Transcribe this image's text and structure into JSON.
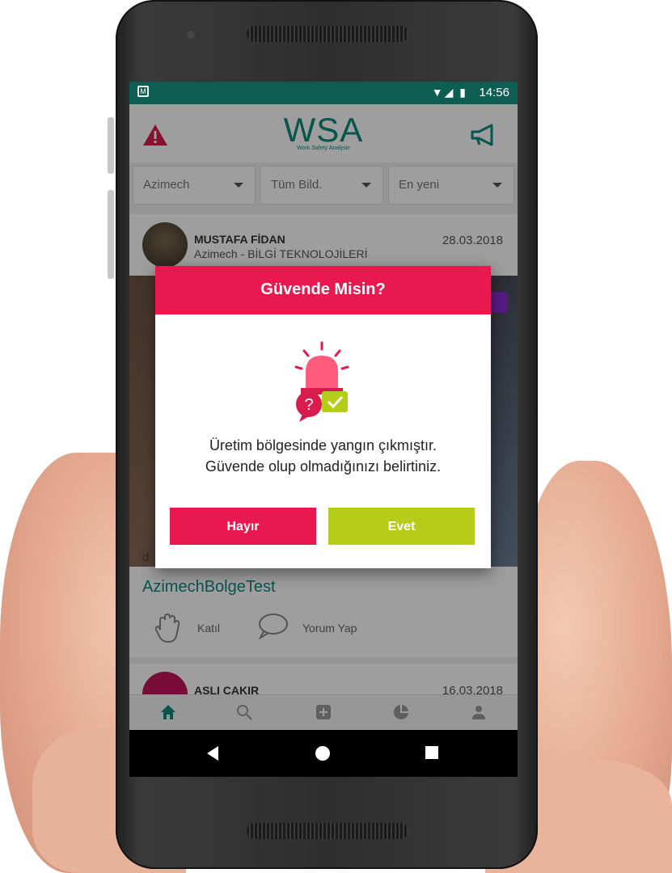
{
  "status_bar": {
    "time": "14:56",
    "left_icon": "M",
    "signal": "▼◢ ▮"
  },
  "app_bar": {
    "logo": "WSA",
    "logo_subtitle": "Work Safety Analysis",
    "left_icon": "warning-icon",
    "right_icon": "megaphone-icon"
  },
  "filters": [
    {
      "label": "Azimech"
    },
    {
      "label": "Tüm Bild."
    },
    {
      "label": "En yeni"
    }
  ],
  "post": {
    "author": "MUSTAFA FİDAN",
    "subtitle": "Azimech -  BİLGİ TEKNOLOJİLERİ",
    "date": "28.03.2018",
    "text": "d",
    "tag": "AzimechBolgeTest",
    "action_join": "Katıl",
    "action_comment": "Yorum Yap"
  },
  "post2": {
    "author": "ASLI CAKIR",
    "date": "16.03.2018"
  },
  "bottom_nav": [
    "home-icon",
    "search-icon",
    "add-icon",
    "chart-icon",
    "profile-icon"
  ],
  "dialog": {
    "title": "Güvende Misin?",
    "message_line1": "Üretim bölgesinde yangın çıkmıştır.",
    "message_line2": "Güvende olup olmadığınızı belirtiniz.",
    "no_label": "Hayır",
    "yes_label": "Evet"
  },
  "colors": {
    "brand_teal": "#0c8a7d",
    "status_bar": "#0c5e52",
    "dialog_red": "#e8194f",
    "dialog_green": "#b5cc18"
  }
}
